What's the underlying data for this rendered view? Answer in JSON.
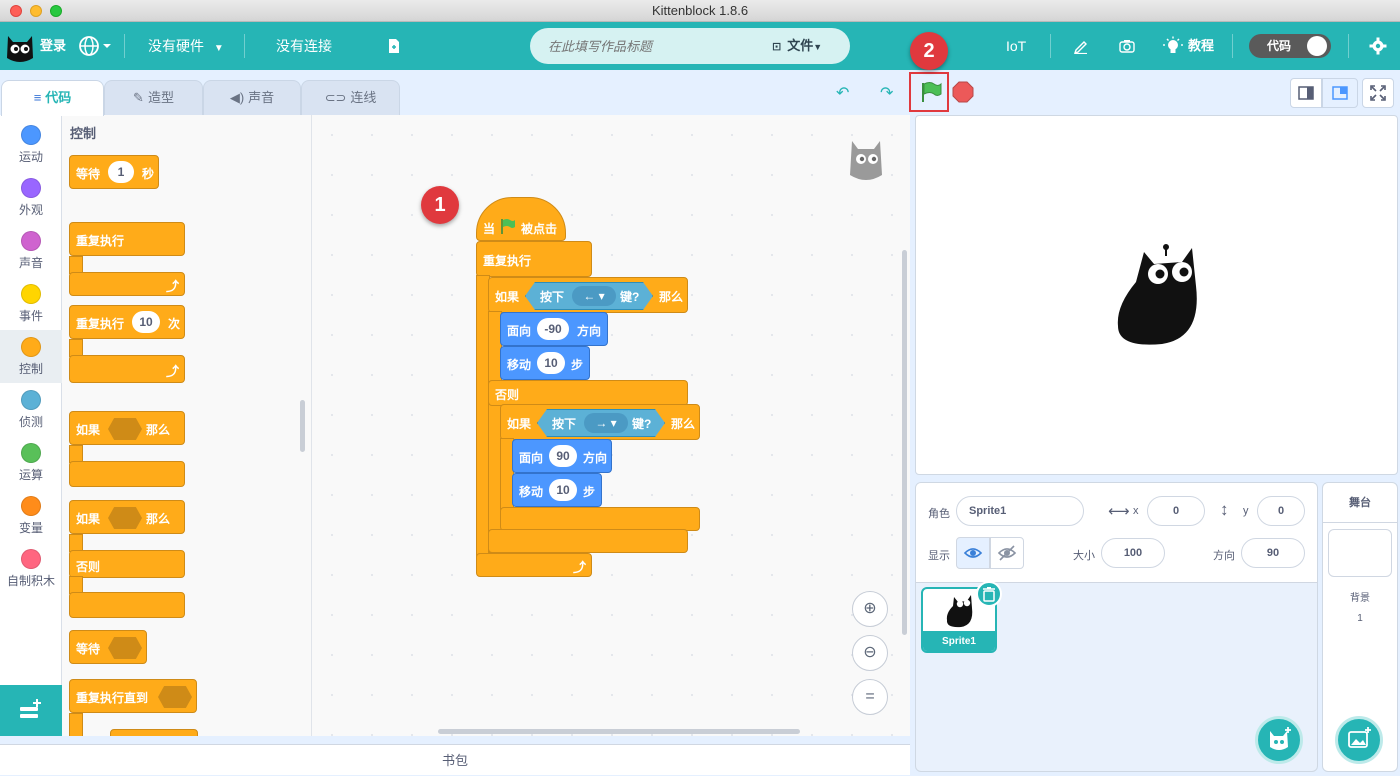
{
  "window": {
    "title": "Kittenblock 1.8.6"
  },
  "menubar": {
    "login": "登录",
    "hardware": "没有硬件",
    "connection": "没有连接",
    "project_title_placeholder": "在此填写作品标题",
    "file": "文件",
    "iot": "IoT",
    "tutorial": "教程",
    "code_toggle": "代码"
  },
  "tabs": [
    {
      "label": "代码",
      "icon": "code-icon"
    },
    {
      "label": "造型",
      "icon": "brush-icon"
    },
    {
      "label": "声音",
      "icon": "speaker-icon"
    },
    {
      "label": "连线",
      "icon": "wiring-icon"
    }
  ],
  "categories": [
    {
      "label": "运动",
      "color": "#4c97ff"
    },
    {
      "label": "外观",
      "color": "#9966ff"
    },
    {
      "label": "声音",
      "color": "#cf63cf"
    },
    {
      "label": "事件",
      "color": "#ffd500"
    },
    {
      "label": "控制",
      "color": "#ffab19"
    },
    {
      "label": "侦测",
      "color": "#5cb1d6"
    },
    {
      "label": "运算",
      "color": "#59c059"
    },
    {
      "label": "变量",
      "color": "#ff8c1a"
    },
    {
      "label": "自制积木",
      "color": "#ff6680"
    }
  ],
  "palette": {
    "heading": "控制",
    "wait": "等待",
    "wait_value": "1",
    "seconds": "秒",
    "forever": "重复执行",
    "repeat": "重复执行",
    "repeat_value": "10",
    "times": "次",
    "if": "如果",
    "then": "那么",
    "if2": "如果",
    "then2": "那么",
    "else": "否则",
    "wait_until": "等待",
    "repeat_until": "重复执行直到"
  },
  "script": {
    "hat_when": "当",
    "hat_clicked": "被点击",
    "forever": "重复执行",
    "if1": "如果",
    "key_pressed1": "按下",
    "key1": "←",
    "key_q1": "键?",
    "then1": "那么",
    "face1": "面向",
    "face1_value": "-90",
    "direction1": "方向",
    "move1": "移动",
    "move1_value": "10",
    "steps1": "步",
    "else": "否则",
    "if2": "如果",
    "key_pressed2": "按下",
    "key2": "→",
    "key_q2": "键?",
    "then2": "那么",
    "face2": "面向",
    "face2_value": "90",
    "direction2": "方向",
    "move2": "移动",
    "move2_value": "10",
    "steps2": "步"
  },
  "annotations": {
    "badge1": "1",
    "badge2": "2"
  },
  "sprite_info": {
    "sprite_label": "角色",
    "sprite_name": "Sprite1",
    "x_label": "x",
    "x_value": "0",
    "y_label": "y",
    "y_value": "0",
    "show_label": "显示",
    "size_label": "大小",
    "size_value": "100",
    "direction_label": "方向",
    "direction_value": "90"
  },
  "sprites": [
    {
      "name": "Sprite1",
      "selected": true
    }
  ],
  "stage_panel": {
    "title": "舞台",
    "backdrop_label": "背景",
    "backdrop_count": "1"
  },
  "backpack": {
    "label": "书包"
  },
  "colors": {
    "accent": "#26b5b5",
    "control": "#ffab19",
    "motion": "#4c97ff",
    "sensing": "#5cb1d6",
    "flag": "#4cbf56",
    "stop": "#ec5959",
    "highlight": "#e0393e"
  }
}
